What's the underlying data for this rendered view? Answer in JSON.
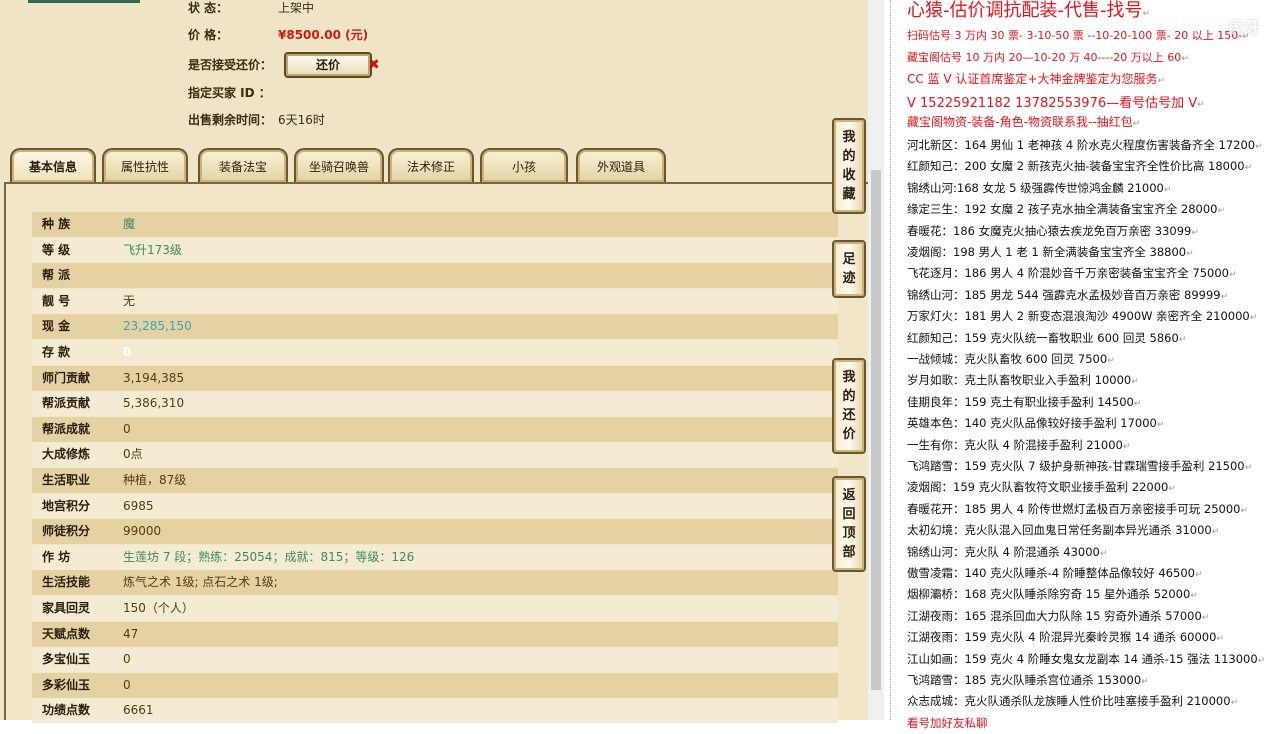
{
  "listing": {
    "status_label": "状 态：",
    "status_value": "上架中",
    "price_label": "价 格：",
    "price_value": "¥8500.00 (元)",
    "accept_label": "是否接受还价：",
    "haggle_button": "还价",
    "haggle_mark": "✖",
    "buyer_label": "指定买家 ID ：",
    "buyer_value": "",
    "time_left_label": "出售剩余时间：",
    "time_left_value": "6天16时"
  },
  "tabs": [
    "基本信息",
    "属性抗性",
    "装备法宝",
    "坐骑召唤兽",
    "法术修正",
    "小孩",
    "外观道具"
  ],
  "attributes": [
    {
      "key": "种 族",
      "value": "魔",
      "style": "green"
    },
    {
      "key": "等 级",
      "value": "飞升173级",
      "style": "green"
    },
    {
      "key": "帮 派",
      "value": "",
      "style": ""
    },
    {
      "key": "靓 号",
      "value": "无",
      "style": ""
    },
    {
      "key": "现 金",
      "value": "23,285,150",
      "style": "teal"
    },
    {
      "key": "存 款",
      "value": "0",
      "style": "white"
    },
    {
      "key": "师门贡献",
      "value": "3,194,385",
      "style": ""
    },
    {
      "key": "帮派贡献",
      "value": "5,386,310",
      "style": ""
    },
    {
      "key": "帮派成就",
      "value": "0",
      "style": ""
    },
    {
      "key": "大成修炼",
      "value": "0点",
      "style": ""
    },
    {
      "key": "生活职业",
      "value": "种植，87级",
      "style": ""
    },
    {
      "key": "地宫积分",
      "value": "6985",
      "style": ""
    },
    {
      "key": "师徒积分",
      "value": "99000",
      "style": ""
    },
    {
      "key": "作 坊",
      "value": "生莲坊 7 段；熟练：25054；成就：815；等级：126",
      "style": "green"
    },
    {
      "key": "生活技能",
      "value": "炼气之术 1级; 点石之术 1级;",
      "style": ""
    },
    {
      "key": "家具回灵",
      "value": "150（个人）",
      "style": ""
    },
    {
      "key": "天赋点数",
      "value": "47",
      "style": ""
    },
    {
      "key": "多宝仙玉",
      "value": "0",
      "style": ""
    },
    {
      "key": "多彩仙玉",
      "value": "0",
      "style": ""
    },
    {
      "key": "功绩点数",
      "value": "6661",
      "style": ""
    }
  ],
  "side_buttons": [
    {
      "name": "favorites",
      "chars": [
        "我",
        "的",
        "收",
        "藏"
      ]
    },
    {
      "name": "footprints",
      "chars": [
        "足",
        "迹"
      ]
    },
    {
      "name": "my-offers",
      "chars": [
        "我",
        "的",
        "还",
        "价"
      ]
    },
    {
      "name": "back-to-top",
      "chars": [
        "返",
        "回",
        "顶",
        "部"
      ]
    }
  ],
  "notes": {
    "header": [
      {
        "text": "心猿-估价调抗配装-代售-找号",
        "size": 18
      },
      {
        "text": "扫码估号 3 万内 30 票- 3-10-50 票 --10-20-100 票- 20 以上 150-",
        "size": 11
      },
      {
        "text": "藏宝阁估号 10 万内 20—10-20 万 40----20 万以上 60",
        "size": 11
      },
      {
        "text": "CC 蓝 V 认证首席鉴定+大神金牌鉴定为您服务",
        "size": 12
      },
      {
        "text": "V 15225921182 13782553976—看号估号加 V",
        "size": 13
      },
      {
        "text": "藏宝阁物资-装备-角色-物资联系我--抽红包",
        "size": 12
      }
    ],
    "lines": [
      "河北新区：164 男仙 1 老神孩 4 阶水克火程度伤害装备齐全 17200",
      "红颜知己：200 女魔 2 新孩克火抽-装备宝宝齐全性价比高 18000",
      "锦绣山河:168 女龙 5 级强霹传世惊鸿金麟 21000",
      "缘定三生：192 女魔 2 孩子克水抽全满装备宝宝齐全 28000",
      "春暖花：186 女魔克火抽心猿去疾龙免百万亲密 33099",
      "凌烟阁：198 男人 1 老 1 新全满装备宝宝齐全 38800",
      "飞花逐月：186 男人 4 阶混妙音千万亲密装备宝宝齐全 75000",
      "锦绣山河：185 男龙 544 强霹克水孟极妙音百万亲密 89999",
      "万家灯火：181 男人 2 新变态混浪淘沙 4900W 亲密齐全 210000",
      "红颜知己：159 克火队统一畜牧职业 600 回灵 5860",
      "一战倾城：克火队畜牧 600 回灵 7500",
      "岁月如歌：克土队畜牧职业入手盈利 10000",
      "佳期良年：159 克土有职业接手盈利 14500",
      "英雄本色：140 克火队品像较好接手盈利 17000",
      "一生有你：克火队 4 阶混接手盈利 21000",
      "飞鸿踏雪：159 克火队 7 级护身新神孩-甘霖瑞雪接手盈利 21500",
      "凌烟阁：159 克火队畜牧符文职业接手盈利 22000",
      "春暖花开：185 男人 4 阶传世燃灯孟极百万亲密接手可玩 25000",
      "太初幻境：克火队混入回血鬼日常任务副本异光通杀 31000",
      "锦绣山河：克火队 4 阶混通杀 43000",
      "傲雪凌霜：140 克火队睡杀-4 阶睡整体品像较好 46500",
      "烟柳灞桥：168 克火队睡杀除穷奇 15 星外通杀 52000",
      "江湖夜雨：165 混杀回血大力队除 15 穷奇外通杀 57000",
      "江湖夜雨：159 克火队 4 阶混异光秦岭灵猴 14 通杀 60000",
      "江山如画：159 克火 4 阶睡女鬼女龙副本 14 通杀-15 强法 113000",
      "飞鸿踏雪：185 克火队睡杀宫位通杀 153000",
      "众志成城：克火队通杀队龙族睡人性价比哇塞接手盈利 210000"
    ],
    "footer": "看号加好友私聊",
    "mark": "↵"
  },
  "watermark": "虎牙"
}
